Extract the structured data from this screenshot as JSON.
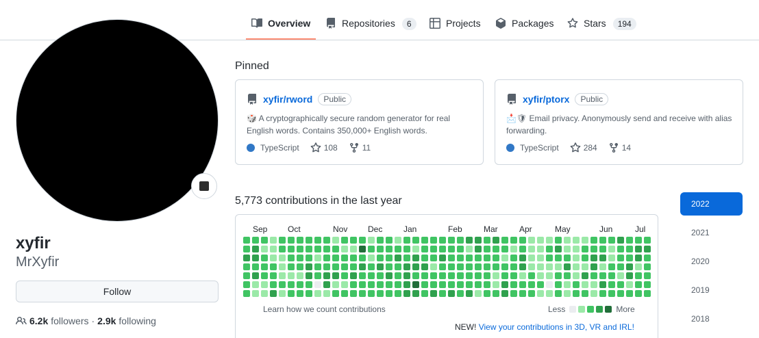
{
  "nav": {
    "tabs": [
      {
        "label": "Overview",
        "icon": "book-icon",
        "active": true
      },
      {
        "label": "Repositories",
        "icon": "repo-icon",
        "count": "6"
      },
      {
        "label": "Projects",
        "icon": "table-icon"
      },
      {
        "label": "Packages",
        "icon": "package-icon"
      },
      {
        "label": "Stars",
        "icon": "star-icon",
        "count": "194"
      }
    ]
  },
  "profile": {
    "name": "xyfir",
    "login": "MrXyfir",
    "follow_label": "Follow",
    "followers_count": "6.2k",
    "followers_label": "followers",
    "separator": "·",
    "following_count": "2.9k",
    "following_label": "following"
  },
  "pinned": {
    "title": "Pinned",
    "cards": [
      {
        "repo": "xyfir/rword",
        "visibility": "Public",
        "description": "🎲 A cryptographically secure random generator for real English words. Contains 350,000+ English words.",
        "language": "TypeScript",
        "language_color": "#3178c6",
        "stars": "108",
        "forks": "11"
      },
      {
        "repo": "xyfir/ptorx",
        "visibility": "Public",
        "description": "📩🛡 Email privacy. Anonymously send and receive with alias forwarding.",
        "language": "TypeScript",
        "language_color": "#3178c6",
        "stars": "284",
        "forks": "14"
      }
    ]
  },
  "contributions": {
    "title": "5,773 contributions in the last year",
    "months": [
      "Sep",
      "Oct",
      "Nov",
      "Dec",
      "Jan",
      "Feb",
      "Mar",
      "Apr",
      "May",
      "Jun",
      "Jul"
    ],
    "learn_label": "Learn how we count contributions",
    "legend_less": "Less",
    "legend_more": "More",
    "new_prefix": "NEW!",
    "new_link": "View your contributions in 3D, VR and IRL!",
    "colors": [
      "#ebedf0",
      "#9be9a8",
      "#40c463",
      "#30a14e",
      "#216e39"
    ],
    "levels": "2232222233231121222111112223221112122221222222122222332222122012222331122231221222122122322242322212122222223222222232212322222223333213324322232222221223223222222222232222222312222333222212222222322211222122332122222223312211112221111121122110123212221123211111112212213122233211223123221122223222122222331223312222322222221222210"
  },
  "years": [
    "2022",
    "2021",
    "2020",
    "2019",
    "2018"
  ],
  "selected_year": "2022"
}
